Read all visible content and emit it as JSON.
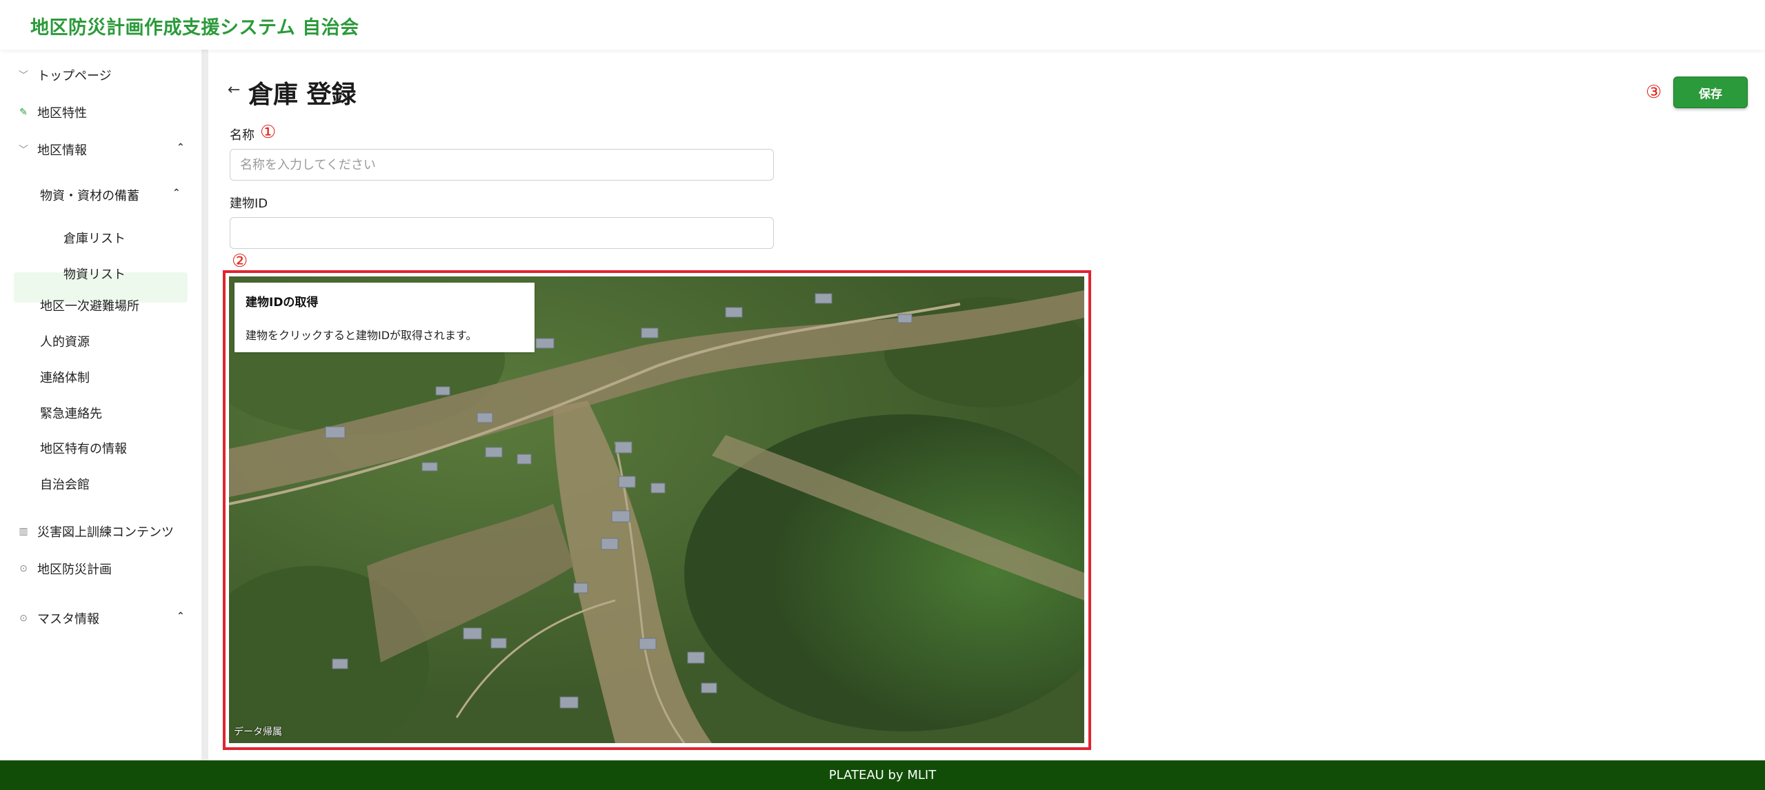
{
  "header": {
    "title": "地区防災計画作成支援システム 自治会"
  },
  "sidebar": {
    "items": [
      {
        "label": "トップページ",
        "icon": "chevron-down-icon"
      },
      {
        "label": "地区特性",
        "icon": "edit-icon"
      },
      {
        "label": "地区情報",
        "icon": "chevron-down-icon",
        "expanded": true
      },
      {
        "label": "物資・資材の備蓄",
        "expanded": true
      },
      {
        "label": "倉庫リスト",
        "active": true
      },
      {
        "label": "物資リスト"
      },
      {
        "label": "地区一次避難場所"
      },
      {
        "label": "人的資源"
      },
      {
        "label": "連絡体制"
      },
      {
        "label": "緊急連絡先"
      },
      {
        "label": "地区特有の情報"
      },
      {
        "label": "自治会館"
      },
      {
        "label": "災害図上訓練コンテンツ",
        "icon": "map-icon"
      },
      {
        "label": "地区防災計画",
        "icon": "circle-icon"
      },
      {
        "label": "マスタ情報",
        "icon": "circle-icon",
        "expanded": true
      }
    ]
  },
  "page": {
    "back": "←",
    "title": "倉庫 登録",
    "save_label": "保存",
    "marks": {
      "one": "①",
      "two": "②",
      "three": "③"
    },
    "mark_color": "#e2231a"
  },
  "form": {
    "name_label": "名称",
    "name_placeholder": "名称を入力してください",
    "name_value": "",
    "building_label": "建物ID",
    "building_value": ""
  },
  "map": {
    "info_title": "建物IDの取得",
    "info_text": "建物をクリックすると建物IDが取得されます。",
    "attribution": "データ帰属"
  },
  "footer": {
    "text": "PLATEAU by MLIT"
  },
  "colors": {
    "brand_green": "#2b9a3a",
    "footer_green": "#114d07",
    "highlight_red": "#e02430"
  }
}
